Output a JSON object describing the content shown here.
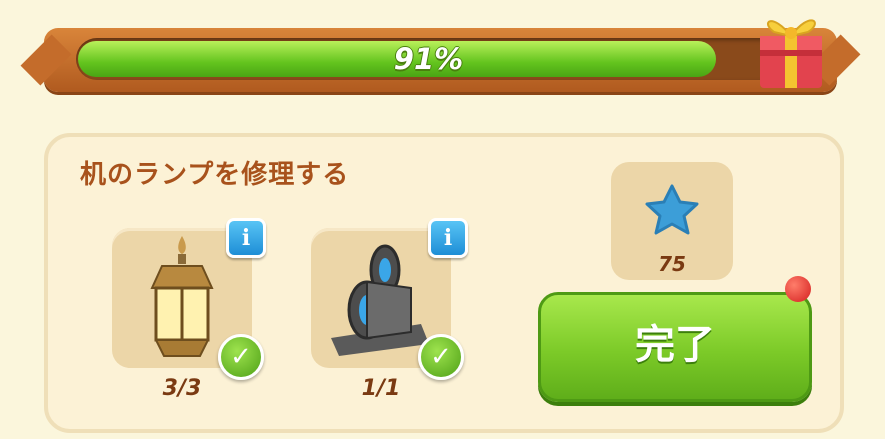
{
  "progress": {
    "percent_label": "91%",
    "value": 0.91,
    "fill_color": "#63c41e"
  },
  "gift_icon": "gift-box-icon",
  "task": {
    "title": "机のランプを修理する",
    "items": [
      {
        "icon": "lantern-icon",
        "count": "3/3",
        "completed": true
      },
      {
        "icon": "duct-tape-icon",
        "count": "1/1",
        "completed": true
      }
    ]
  },
  "reward": {
    "icon": "blue-star-icon",
    "value": "75"
  },
  "complete_button": {
    "label": "完了",
    "color": "#7cca28"
  },
  "info_label": "i",
  "check_glyph": "✓"
}
